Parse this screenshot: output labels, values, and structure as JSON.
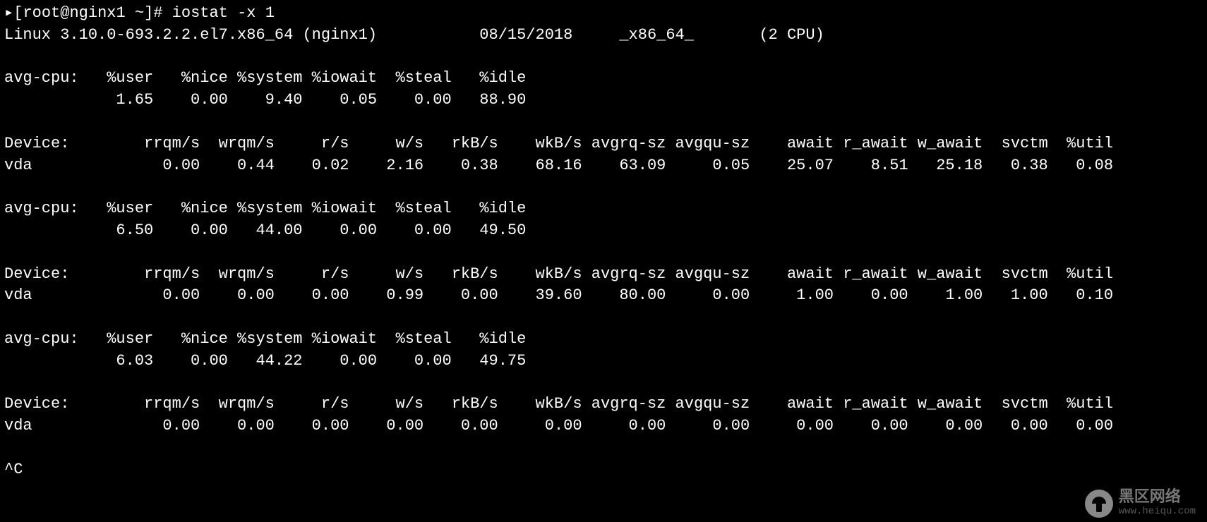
{
  "prompt": {
    "marker": "▸",
    "user_host": "[root@nginx1 ~]#",
    "command": "iostat -x 1"
  },
  "sysline": {
    "kernel": "Linux 3.10.0-693.2.2.el7.x86_64 (nginx1)",
    "date": "08/15/2018",
    "arch": "_x86_64_",
    "cpu": "(2 CPU)"
  },
  "cpu_headers": [
    "avg-cpu:",
    "%user",
    "%nice",
    "%system",
    "%iowait",
    "%steal",
    "%idle"
  ],
  "dev_headers": [
    "Device:",
    "rrqm/s",
    "wrqm/s",
    "r/s",
    "w/s",
    "rkB/s",
    "wkB/s",
    "avgrq-sz",
    "avgqu-sz",
    "await",
    "r_await",
    "w_await",
    "svctm",
    "%util"
  ],
  "samples": [
    {
      "cpu": [
        "1.65",
        "0.00",
        "9.40",
        "0.05",
        "0.00",
        "88.90"
      ],
      "dev": [
        "vda",
        "0.00",
        "0.44",
        "0.02",
        "2.16",
        "0.38",
        "68.16",
        "63.09",
        "0.05",
        "25.07",
        "8.51",
        "25.18",
        "0.38",
        "0.08"
      ]
    },
    {
      "cpu": [
        "6.50",
        "0.00",
        "44.00",
        "0.00",
        "0.00",
        "49.50"
      ],
      "dev": [
        "vda",
        "0.00",
        "0.00",
        "0.00",
        "0.99",
        "0.00",
        "39.60",
        "80.00",
        "0.00",
        "1.00",
        "0.00",
        "1.00",
        "1.00",
        "0.10"
      ]
    },
    {
      "cpu": [
        "6.03",
        "0.00",
        "44.22",
        "0.00",
        "0.00",
        "49.75"
      ],
      "dev": [
        "vda",
        "0.00",
        "0.00",
        "0.00",
        "0.00",
        "0.00",
        "0.00",
        "0.00",
        "0.00",
        "0.00",
        "0.00",
        "0.00",
        "0.00",
        "0.00"
      ]
    }
  ],
  "interrupt": "^C",
  "watermark": {
    "title": "黑区网络",
    "url": "www.heiqu.com"
  }
}
